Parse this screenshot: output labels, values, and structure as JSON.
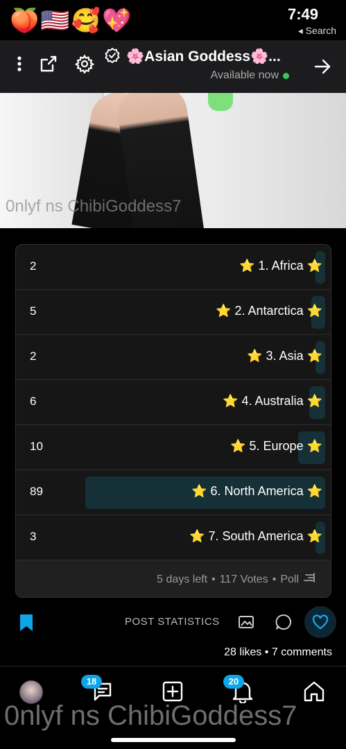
{
  "status_bar": {
    "emojis": [
      "🍑",
      "🇺🇸",
      "🥰",
      "💖"
    ],
    "time": "7:49",
    "back_app": "◂ Search"
  },
  "header": {
    "title": "🌸Asian Goddess🌸...",
    "status": "Available now",
    "status_color": "#34c759"
  },
  "photo": {
    "watermark": "0nlyf ns ChibiGoddess7"
  },
  "poll": {
    "options": [
      {
        "label": "⭐ 1. Africa ⭐",
        "count": "2",
        "fraction": 0.017
      },
      {
        "label": "⭐ 2. Antarctica ⭐",
        "count": "5",
        "fraction": 0.043
      },
      {
        "label": "⭐ 3. Asia ⭐",
        "count": "2",
        "fraction": 0.017
      },
      {
        "label": "⭐ 4. Australia ⭐",
        "count": "6",
        "fraction": 0.051
      },
      {
        "label": "⭐ 5. Europe ⭐",
        "count": "10",
        "fraction": 0.085
      },
      {
        "label": "⭐ 6. North America ⭐",
        "count": "89",
        "fraction": 0.761
      },
      {
        "label": "⭐ 7. South America ⭐",
        "count": "3",
        "fraction": 0.026
      }
    ],
    "footer": {
      "kind": "Poll",
      "votes": "117 Votes",
      "time_left": "5 days left"
    },
    "bar_color": "#163038"
  },
  "actions": {
    "post_statistics": "POST STATISTICS",
    "likes_comments": "28 likes • 7 comments",
    "accent": "#0ea5e9"
  },
  "nav": {
    "messages_badge": "18",
    "notifications_badge": "20",
    "watermark": "0nlyf ns ChibiGoddess7"
  }
}
